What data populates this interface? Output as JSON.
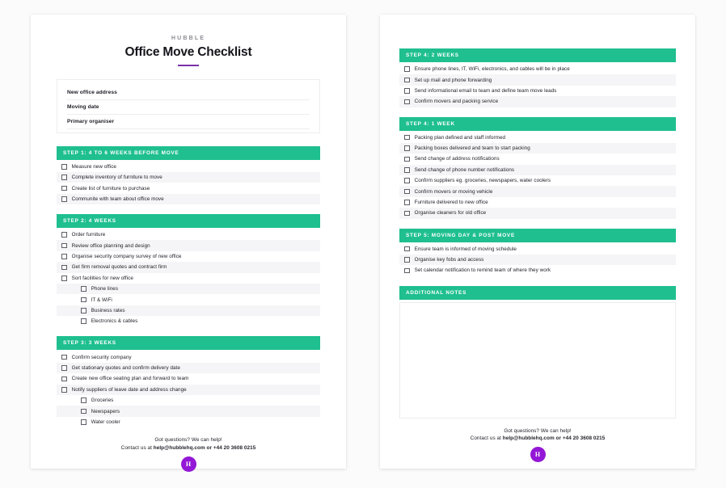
{
  "header": {
    "brand": "HUBBLE",
    "title": "Office Move Checklist"
  },
  "colors": {
    "section_green": "#1fbf8f",
    "accent_purple": "#7b2fa8",
    "logo_purple": "#9317d6",
    "row_alt": "#f5f5f7"
  },
  "fields": [
    {
      "label": "New office address"
    },
    {
      "label": "Moving date"
    },
    {
      "label": "Primary organiser"
    }
  ],
  "sections": [
    {
      "id": "step-1",
      "title": "STEP 1: 4 TO 6 WEEKS BEFORE MOVE",
      "items": [
        {
          "label": "Measure new office",
          "sub": false
        },
        {
          "label": "Complete inventory of furniture to move",
          "sub": false
        },
        {
          "label": "Create list of furniture to purchase",
          "sub": false
        },
        {
          "label": "Communite with team about office move",
          "sub": false
        }
      ]
    },
    {
      "id": "step-2",
      "title": "STEP 2: 4 WEEKS",
      "items": [
        {
          "label": "Order furniture",
          "sub": false
        },
        {
          "label": "Review office planning and design",
          "sub": false
        },
        {
          "label": "Organise security company survey of new office",
          "sub": false
        },
        {
          "label": "Get firm removal quotes and contract firm",
          "sub": false
        },
        {
          "label": "Sort facilities for new office",
          "sub": false
        },
        {
          "label": "Phone lines",
          "sub": true
        },
        {
          "label": "IT & WiFi",
          "sub": true
        },
        {
          "label": "Business rates",
          "sub": true
        },
        {
          "label": "Electronics & cables",
          "sub": true
        }
      ]
    },
    {
      "id": "step-3",
      "title": "STEP 3: 3 WEEKS",
      "items": [
        {
          "label": "Confirm security company",
          "sub": false
        },
        {
          "label": "Get stationary quotes and confirm delivery date",
          "sub": false
        },
        {
          "label": "Create new office seating plan and forward to team",
          "sub": false
        },
        {
          "label": "Notify suppliers of leave date and address change",
          "sub": false
        },
        {
          "label": "Groceries",
          "sub": true
        },
        {
          "label": "Newspapers",
          "sub": true
        },
        {
          "label": "Water cooler",
          "sub": true
        }
      ]
    },
    {
      "id": "step-4-2-weeks",
      "title": "STEP 4: 2 WEEKS",
      "items": [
        {
          "label": "Ensure phone lines, IT, WiFi, electronics, and cables will be in place",
          "sub": false
        },
        {
          "label": "Set up mail and phone forwarding",
          "sub": false
        },
        {
          "label": "Send informational email to team and define team move leads",
          "sub": false
        },
        {
          "label": "Confirm movers and packing service",
          "sub": false
        }
      ]
    },
    {
      "id": "step-4-1-week",
      "title": "STEP 4: 1 WEEK",
      "items": [
        {
          "label": "Packing plan defined and staff informed",
          "sub": false
        },
        {
          "label": "Packing boxes delivered and team to start packing",
          "sub": false
        },
        {
          "label": "Send change of address notifications",
          "sub": false
        },
        {
          "label": "Send change of phone number notifications",
          "sub": false
        },
        {
          "label": "Confirm suppliers eg. groceries, newspapers, water coolers",
          "sub": false
        },
        {
          "label": "Confirm movers or moving vehicle",
          "sub": false
        },
        {
          "label": "Furniture delivered to new office",
          "sub": false
        },
        {
          "label": "Organise cleaners for old office",
          "sub": false
        }
      ]
    },
    {
      "id": "step-5",
      "title": "STEP 5: MOVING DAY & POST MOVE",
      "items": [
        {
          "label": "Ensure team is informed of moving schedule",
          "sub": false
        },
        {
          "label": "Organise key fobs and access",
          "sub": false
        },
        {
          "label": "Set calendar notification to remind team of where they work",
          "sub": false
        }
      ]
    }
  ],
  "notes": {
    "title": "ADDITIONAL NOTES",
    "content": ""
  },
  "footer": {
    "line1": "Got questions? We can help!",
    "line2_prefix": "Contact us at ",
    "line2_contact": "help@hubblehq.com or +44 20 3608 0215",
    "logo_letter": "H"
  }
}
